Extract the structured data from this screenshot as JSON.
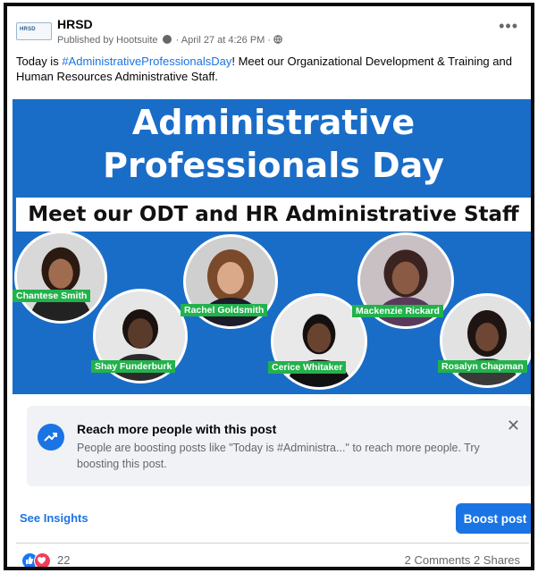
{
  "post": {
    "logo_text": "HRSD",
    "page_name": "HRSD",
    "meta": "Published by Hootsuite",
    "date": "April 27 at 4:26 PM",
    "more_icon": "more-horizontal-icon",
    "text_before": "Today is ",
    "hashtag": "#AdministrativeProfessionalsDay",
    "text_after": "! Meet our Organizational Development & Training and Human Resources Administrative Staff."
  },
  "banner": {
    "title_line1": "Administrative",
    "title_line2": "Professionals Day",
    "subtitle": "Meet our ODT and HR Administrative Staff",
    "people": [
      {
        "name": "Chantese Smith"
      },
      {
        "name": "Shay Funderburk"
      },
      {
        "name": "Rachel Goldsmith"
      },
      {
        "name": "Cerice Whitaker"
      },
      {
        "name": "Mackenzie Rickard"
      },
      {
        "name": "Rosalyn Chapman"
      }
    ],
    "colors": {
      "background": "#1a6dc7",
      "nametag": "#22b24c"
    }
  },
  "boost_card": {
    "title": "Reach more people with this post",
    "body": "People are boosting posts like \"Today is #Administra...\" to reach more people. Try boosting this post.",
    "close_label": "✕"
  },
  "actions": {
    "see_insights": "See Insights",
    "boost_post": "Boost post"
  },
  "footer": {
    "reaction_count": "22",
    "comments": "2 Comments",
    "shares": "2 Shares"
  },
  "colors": {
    "accent": "#1b74e4",
    "like": "#1877f2",
    "love": "#f33e58"
  }
}
